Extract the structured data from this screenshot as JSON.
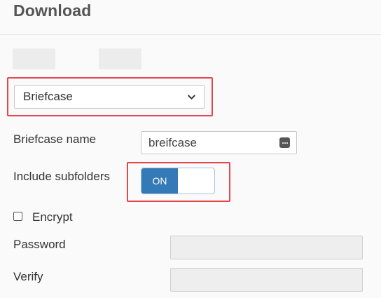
{
  "dialog": {
    "title": "Download"
  },
  "type_select": {
    "value": "Briefcase"
  },
  "briefcase_name": {
    "label": "Briefcase name",
    "value": "breifcase"
  },
  "subfolders": {
    "label": "Include subfolders",
    "state": "ON"
  },
  "encrypt": {
    "label": "Encrypt",
    "checked": false
  },
  "password": {
    "label": "Password",
    "value": ""
  },
  "verify": {
    "label": "Verify",
    "value": ""
  },
  "colors": {
    "accent": "#337ab7",
    "highlight": "#e2474e"
  }
}
